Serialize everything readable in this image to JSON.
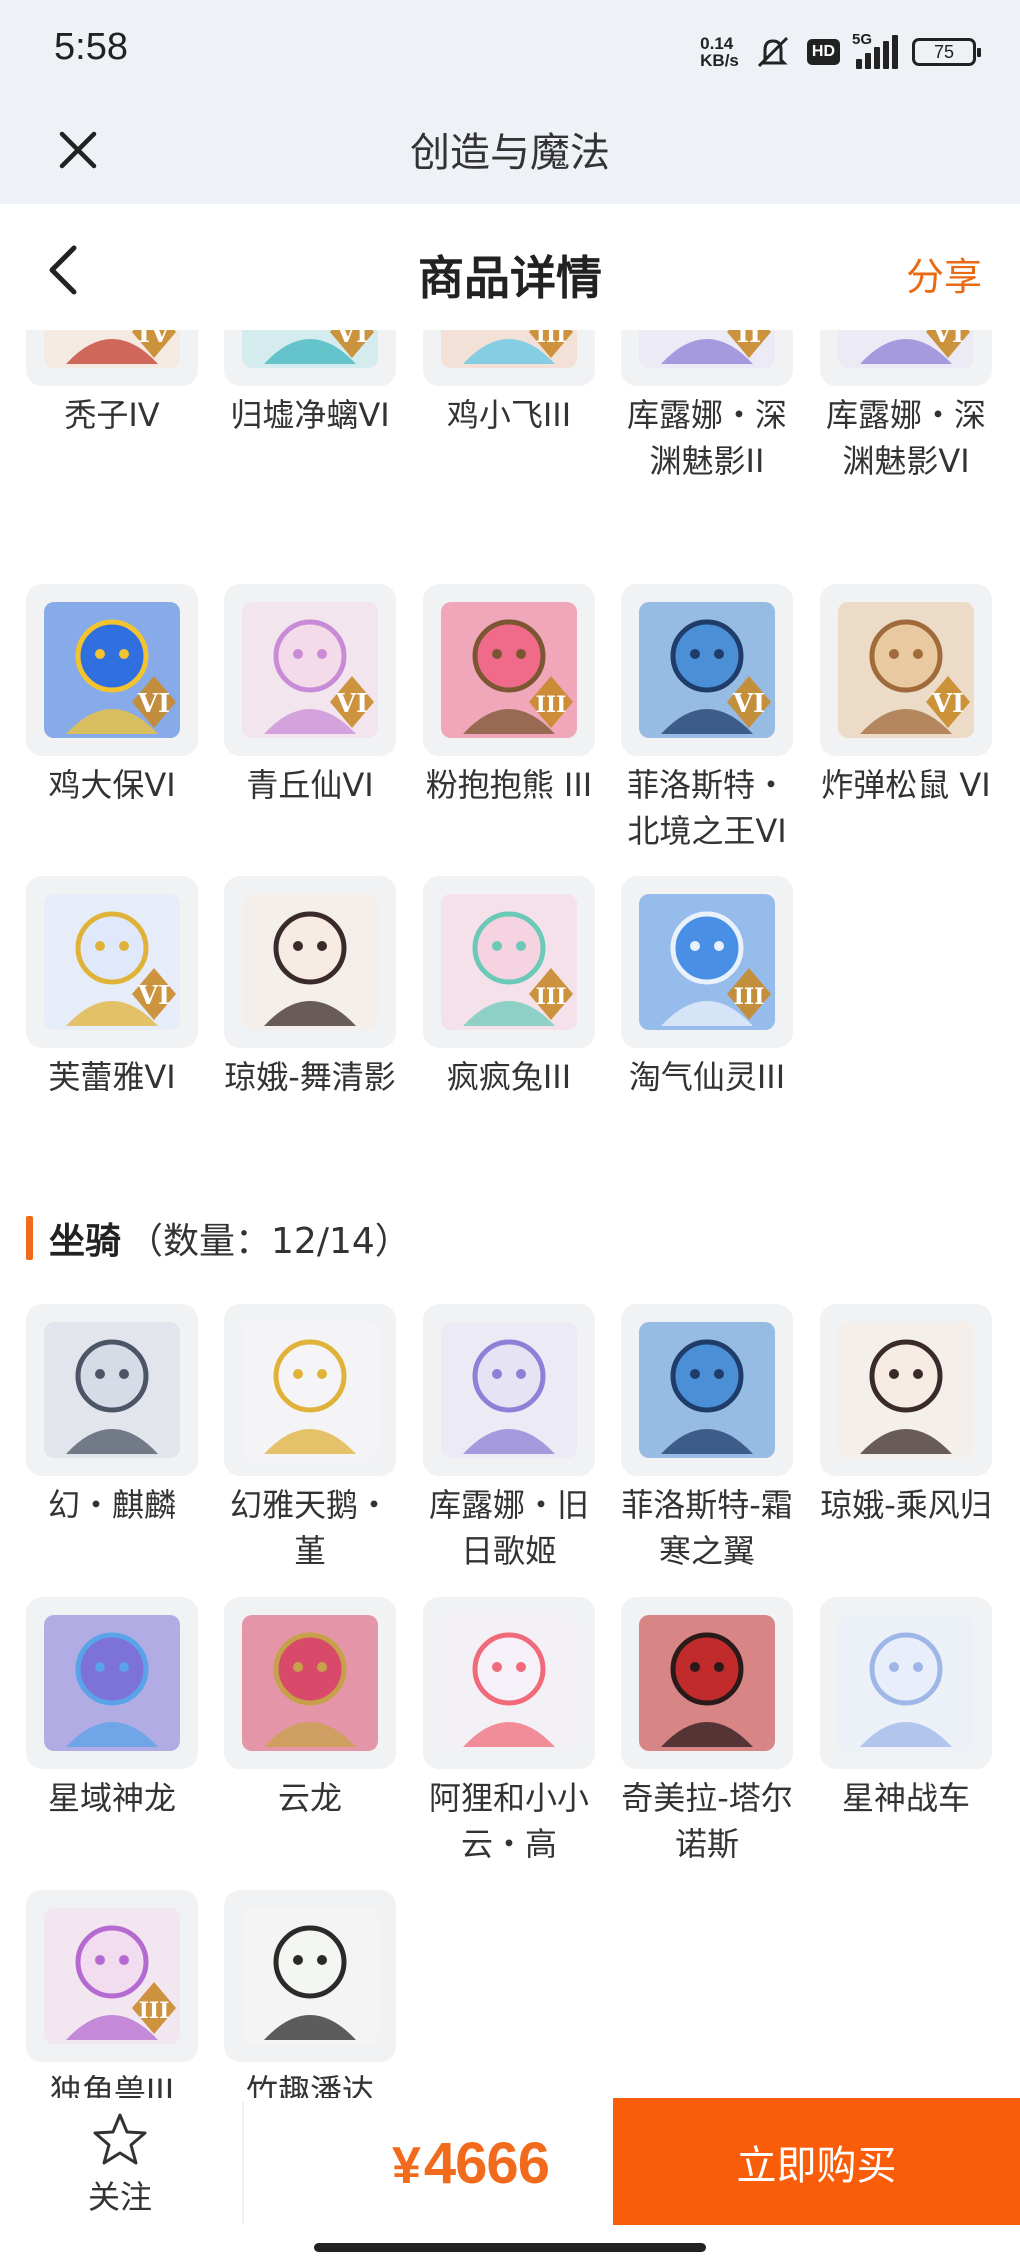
{
  "status_bar": {
    "time": "5:58",
    "net_speed_value": "0.14",
    "net_speed_unit": "KB/s",
    "hd": "HD",
    "network": "5G",
    "battery": "75"
  },
  "app_bar": {
    "title": "创造与魔法"
  },
  "header": {
    "title": "商品详情",
    "share": "分享"
  },
  "pets_section": {
    "items": [
      {
        "label": "秃子IV",
        "icon": "bald-character-icon",
        "tier": "IV"
      },
      {
        "label": "归墟净螭VI",
        "icon": "teal-dragon-icon",
        "tier": "VI"
      },
      {
        "label": "鸡小飞III",
        "icon": "blue-chick-icon",
        "tier": "III"
      },
      {
        "label": "库露娜・深渊魅影II",
        "icon": "white-haired-girl-icon",
        "tier": "II"
      },
      {
        "label": "库露娜・深渊魅影VI",
        "icon": "white-haired-girl-icon",
        "tier": "VI"
      },
      {
        "label": "鸡大保VI",
        "icon": "blue-bird-icon",
        "tier": "VI"
      },
      {
        "label": "青丘仙VI",
        "icon": "fox-fairy-icon",
        "tier": "VI"
      },
      {
        "label": "粉抱抱熊 III",
        "icon": "pink-bear-icon",
        "tier": "III"
      },
      {
        "label": "菲洛斯特・北境之王VI",
        "icon": "ice-king-icon",
        "tier": "VI"
      },
      {
        "label": "炸弹松鼠 VI",
        "icon": "squirrel-icon",
        "tier": "VI"
      },
      {
        "label": "芙蕾雅VI",
        "icon": "golden-crown-girl-icon",
        "tier": "VI"
      },
      {
        "label": "琼娥-舞清影",
        "icon": "moon-fairy-icon",
        "tier": ""
      },
      {
        "label": "疯疯兔III",
        "icon": "pink-rabbit-icon",
        "tier": "III"
      },
      {
        "label": "淘气仙灵III",
        "icon": "blue-pup-icon",
        "tier": "III"
      }
    ]
  },
  "mounts_section": {
    "name": "坐骑",
    "count": "（数量：12/14）",
    "items": [
      {
        "label": "幻・麒麟",
        "icon": "qilin-icon",
        "tier": ""
      },
      {
        "label": "幻雅天鹅・堇",
        "icon": "swan-icon",
        "tier": ""
      },
      {
        "label": "库露娜・旧日歌姬",
        "icon": "white-haired-girl-icon",
        "tier": ""
      },
      {
        "label": "菲洛斯特-霜寒之翼",
        "icon": "ice-king-icon",
        "tier": ""
      },
      {
        "label": "琼娥-乘风归",
        "icon": "moon-fairy-icon",
        "tier": ""
      },
      {
        "label": "星域神龙",
        "icon": "star-dragon-icon",
        "tier": ""
      },
      {
        "label": "云龙",
        "icon": "cloud-dragon-icon",
        "tier": ""
      },
      {
        "label": "阿狸和小小云・高",
        "icon": "ahri-cloud-icon",
        "tier": ""
      },
      {
        "label": "奇美拉-塔尔诺斯",
        "icon": "chimera-icon",
        "tier": ""
      },
      {
        "label": "星神战车",
        "icon": "star-chariot-icon",
        "tier": ""
      },
      {
        "label": "独角兽III",
        "icon": "unicorn-icon",
        "tier": "III"
      },
      {
        "label": "竹趣潘达",
        "icon": "panda-icon",
        "tier": ""
      }
    ]
  },
  "bottom_bar": {
    "follow": "关注",
    "currency": "¥",
    "price": "4666",
    "buy": "立即购买"
  },
  "colors": {
    "accent": "#f26b1c",
    "buy_button": "#fa5d0a",
    "bar_bg": "#eef1f6"
  }
}
